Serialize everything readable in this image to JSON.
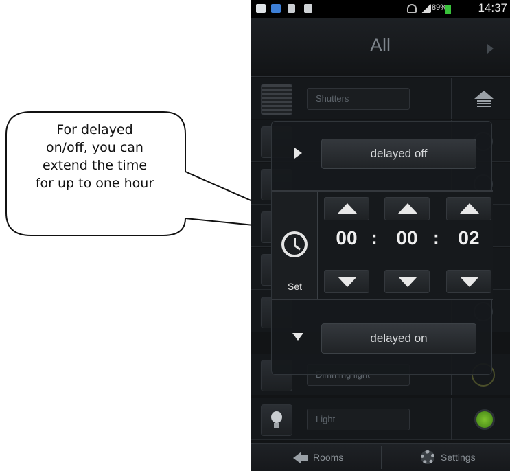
{
  "callout": {
    "lines": [
      "For delayed",
      "on/off, you can",
      "extend the time",
      "for up to one hour"
    ]
  },
  "status_bar": {
    "battery": "89%",
    "time": "14:37"
  },
  "header": {
    "title": "All"
  },
  "rows": [
    {
      "label": "Shutters",
      "icon": "shutter-icon"
    },
    {
      "label": "",
      "icon": "fan-icon"
    },
    {
      "label": "",
      "icon": "bulb-icon"
    },
    {
      "label": "",
      "icon": "fan-icon"
    },
    {
      "label": "",
      "icon": "bulb-icon"
    },
    {
      "label": "",
      "icon": "fan-icon"
    },
    {
      "label": "Dimming light",
      "icon": "bulb-icon"
    },
    {
      "label": "Light",
      "icon": "bulb-icon"
    }
  ],
  "popup": {
    "delayed_off_label": "delayed off",
    "delayed_on_label": "delayed on",
    "set_label": "Set",
    "hours": "00",
    "minutes": "00",
    "seconds": "02",
    "separator": ":"
  },
  "bottom_bar": {
    "rooms_label": "Rooms",
    "settings_label": "Settings"
  },
  "colors": {
    "indicator_on": "#4c8f1a",
    "battery": "#38c23a"
  }
}
